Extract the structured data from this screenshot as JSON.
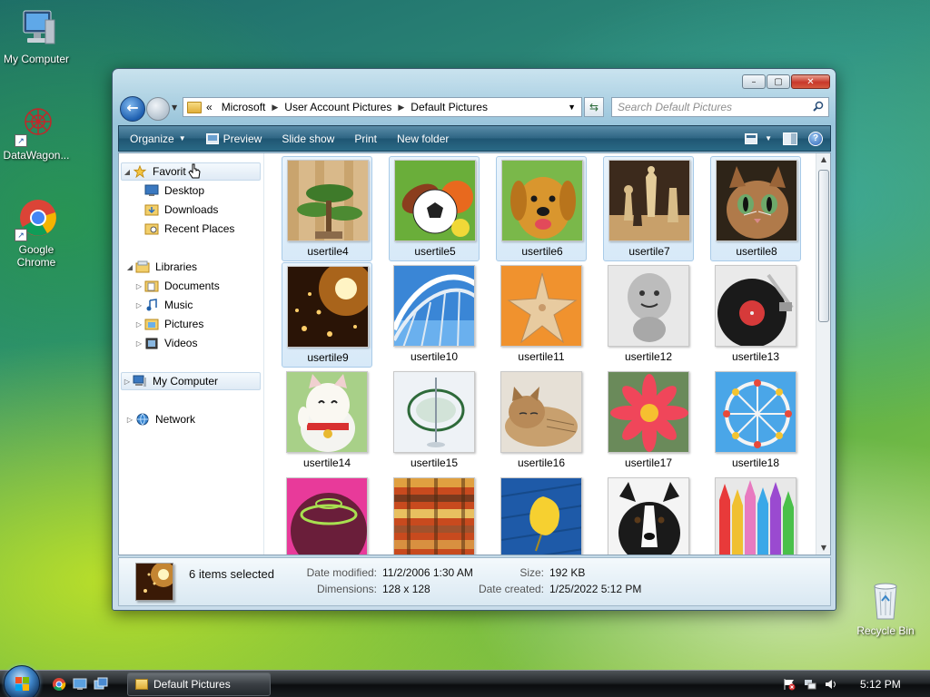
{
  "desktop": {
    "icons": [
      {
        "label": "My Computer"
      },
      {
        "label": "DataWagon..."
      },
      {
        "label": "Google Chrome"
      },
      {
        "label": "Recycle Bin"
      }
    ]
  },
  "window": {
    "controls": {
      "minimize": "–",
      "maximize": "▢",
      "close": "✕"
    },
    "address": {
      "overflow": "«",
      "crumbs": [
        "Microsoft",
        "User Account Pictures",
        "Default Pictures"
      ]
    },
    "search": {
      "placeholder": "Search Default Pictures"
    },
    "toolbar": {
      "organize": "Organize",
      "preview": "Preview",
      "slideshow": "Slide show",
      "print": "Print",
      "new_folder": "New folder",
      "help": "?"
    },
    "navpane": {
      "favorites": "Favorites",
      "favorites_visible": "Favorit",
      "desktop": "Desktop",
      "downloads": "Downloads",
      "recent_places": "Recent Places",
      "libraries": "Libraries",
      "documents": "Documents",
      "music": "Music",
      "pictures": "Pictures",
      "videos": "Videos",
      "my_computer": "My Computer",
      "network": "Network"
    },
    "files": [
      {
        "name": "usertile4",
        "selected": true
      },
      {
        "name": "usertile5",
        "selected": true
      },
      {
        "name": "usertile6",
        "selected": true
      },
      {
        "name": "usertile7",
        "selected": true
      },
      {
        "name": "usertile8",
        "selected": true
      },
      {
        "name": "usertile9",
        "selected": true
      },
      {
        "name": "usertile10",
        "selected": false
      },
      {
        "name": "usertile11",
        "selected": false
      },
      {
        "name": "usertile12",
        "selected": false
      },
      {
        "name": "usertile13",
        "selected": false
      },
      {
        "name": "usertile14",
        "selected": false
      },
      {
        "name": "usertile15",
        "selected": false
      },
      {
        "name": "usertile16",
        "selected": false
      },
      {
        "name": "usertile17",
        "selected": false
      },
      {
        "name": "usertile18",
        "selected": false
      }
    ],
    "details": {
      "count": "6 items selected",
      "date_modified_label": "Date modified:",
      "date_modified": "11/2/2006 1:30 AM",
      "dimensions_label": "Dimensions:",
      "dimensions": "128 x 128",
      "size_label": "Size:",
      "size": "192 KB",
      "date_created_label": "Date created:",
      "date_created": "1/25/2022 5:12 PM"
    }
  },
  "taskbar": {
    "task_label": "Default Pictures",
    "clock": "5:12 PM"
  },
  "colors": {
    "toolbar": "#2f6684",
    "selection": "#d7e9f8",
    "close_button": "#c8382a"
  }
}
